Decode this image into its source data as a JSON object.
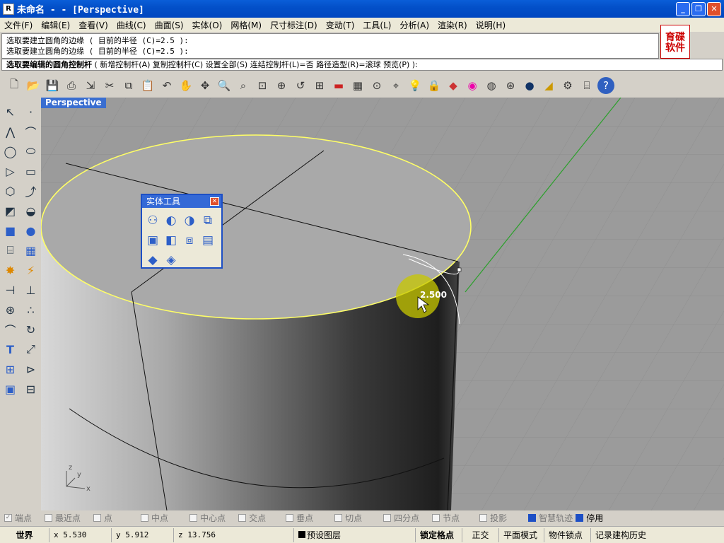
{
  "titlebar": {
    "app_icon": "rhino-icon",
    "title": "未命名 - - [Perspective]"
  },
  "window_buttons": {
    "minimize": "_",
    "maximize": "❐",
    "close": "✕"
  },
  "menu": [
    "文件(F)",
    "编辑(E)",
    "查看(V)",
    "曲线(C)",
    "曲面(S)",
    "实体(O)",
    "网格(M)",
    "尺寸标注(D)",
    "变动(T)",
    "工具(L)",
    "分析(A)",
    "渲染(R)",
    "说明(H)"
  ],
  "command_history": [
    "选取要建立圆角的边缘 ( 目前的半径 (C)=2.5 ):",
    "选取要建立圆角的边缘 ( 目前的半径 (C)=2.5 ):"
  ],
  "logo": {
    "line1": "育碟",
    "line2": "软件"
  },
  "command_prompt": {
    "bold": "选取要编辑的圆角控制杆",
    "rest": "( 新增控制杆(A)  复制控制杆(C)  设置全部(S)  连结控制杆(L)=否  路径造型(R)=滚球  预览(P) ):"
  },
  "toolbar_icons": [
    "new-file-icon",
    "open-folder-icon",
    "save-icon",
    "print-icon",
    "import-icon",
    "cut-icon",
    "copy-icon",
    "paste-icon",
    "undo-icon",
    "pan-hand-icon",
    "rotate-view-icon",
    "zoom-in-icon",
    "zoom-window-icon",
    "zoom-extents-icon",
    "zoom-selected-icon",
    "undo-view-icon",
    "four-viewports-icon",
    "car-icon",
    "grid-icon",
    "snap-icon",
    "osnap-icon",
    "lightbulb-icon",
    "lock-icon",
    "layer-icon",
    "color-wheel-icon",
    "sphere-wire-icon",
    "sphere-mesh-icon",
    "render-sphere-icon",
    "light-icon",
    "gear-icon",
    "dimension-icon",
    "help-icon"
  ],
  "left_tools": [
    "select-arrow-icon",
    "point-icon",
    "polyline-icon",
    "curve-points-icon",
    "circle-icon",
    "ellipse-icon",
    "arc-icon",
    "rectangle-icon",
    "polygon-icon",
    "curve-tool-icon",
    "surface-icon",
    "surface-edge-icon",
    "box-icon",
    "sphere-icon",
    "cylinder-icon",
    "mesh-icon",
    "explode-icon",
    "trim-icon",
    "split-icon",
    "join-icon",
    "boolean-icon",
    "array-icon",
    "bend-icon",
    "rotate-icon",
    "text-icon",
    "scale-icon",
    "grid-array-icon",
    "transform-icon",
    "solid-box-icon",
    "dimension-ruler-icon"
  ],
  "viewport": {
    "label": "Perspective",
    "fillet_radius": "2.500",
    "axis_x": "x",
    "axis_y": "y",
    "axis_z": "z"
  },
  "solid_tools": {
    "title": "实体工具",
    "icons": [
      "boolean-union-icon",
      "boolean-difference-icon",
      "boolean-intersect-icon",
      "boolean-split-icon",
      "extract-face-icon",
      "cap-icon",
      "shell-icon",
      "fillet-edge-icon",
      "blend-edge-icon",
      "chamfer-icon"
    ]
  },
  "osnap": [
    {
      "label": "端点",
      "on": false,
      "check": "✓"
    },
    {
      "label": "最近点",
      "on": false
    },
    {
      "label": "点",
      "on": false
    },
    {
      "label": "中点",
      "on": false
    },
    {
      "label": "中心点",
      "on": false
    },
    {
      "label": "交点",
      "on": false
    },
    {
      "label": "垂点",
      "on": false
    },
    {
      "label": "切点",
      "on": false
    },
    {
      "label": "四分点",
      "on": false
    },
    {
      "label": "节点",
      "on": false
    },
    {
      "label": "投影",
      "on": false
    },
    {
      "label": "智慧轨迹",
      "on": true
    },
    {
      "label": "停用",
      "on": true
    }
  ],
  "status": {
    "cplane": "世界",
    "x": "x 5.530",
    "y": "y 5.912",
    "z": "z 13.756",
    "layer": "预设图层",
    "snap": "锁定格点",
    "ortho": "正交",
    "planar": "平面模式",
    "osnap": "物件锁点",
    "history": "记录建构历史"
  },
  "colors": {
    "edge_highlight": "#ffff66",
    "cplane_y_axis": "#2ca02c",
    "viewport_bg": "#9b9b9b"
  }
}
